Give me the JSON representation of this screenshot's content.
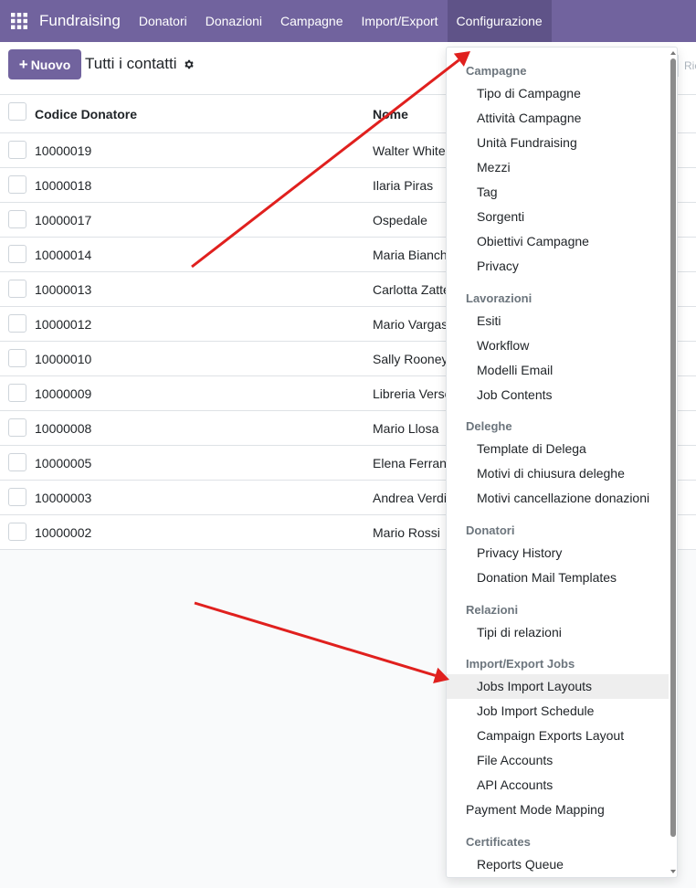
{
  "navbar": {
    "apps_icon": "grid-icon",
    "brand": "Fundraising",
    "menu": [
      "Donatori",
      "Donazioni",
      "Campagne",
      "Import/Export",
      "Configurazione"
    ],
    "accent_color": "#71639e"
  },
  "control_panel": {
    "new_button": "Nuovo",
    "breadcrumb": "Tutti i contatti",
    "settings_icon": "gear-icon",
    "search_placeholder": "Ric"
  },
  "list": {
    "columns": [
      "Codice Donatore",
      "Nome"
    ],
    "rows": [
      {
        "code": "10000019",
        "name": "Walter White"
      },
      {
        "code": "10000018",
        "name": "Ilaria Piras"
      },
      {
        "code": "10000017",
        "name": "Ospedale"
      },
      {
        "code": "10000014",
        "name": "Maria Bianchi"
      },
      {
        "code": "10000013",
        "name": "Carlotta Zatterin"
      },
      {
        "code": "10000012",
        "name": "Mario Vargas"
      },
      {
        "code": "10000010",
        "name": "Sally Rooney"
      },
      {
        "code": "10000009",
        "name": "Libreria Verso"
      },
      {
        "code": "10000008",
        "name": "Mario Llosa"
      },
      {
        "code": "10000005",
        "name": "Elena Ferrante"
      },
      {
        "code": "10000003",
        "name": "Andrea Verdi"
      },
      {
        "code": "10000002",
        "name": "Mario Rossi"
      }
    ]
  },
  "dropdown": {
    "sections": [
      {
        "header": "Campagne",
        "items": [
          "Tipo di Campagne",
          "Attività Campagne",
          "Unità Fundraising",
          "Mezzi",
          "Tag",
          "Sorgenti",
          "Obiettivi Campagne",
          "Privacy"
        ]
      },
      {
        "header": "Lavorazioni",
        "items": [
          "Esiti",
          "Workflow",
          "Modelli Email",
          "Job Contents"
        ]
      },
      {
        "header": "Deleghe",
        "items": [
          "Template di Delega",
          "Motivi di chiusura deleghe",
          "Motivi cancellazione donazioni"
        ]
      },
      {
        "header": "Donatori",
        "items": [
          "Privacy History",
          "Donation Mail Templates"
        ]
      },
      {
        "header": "Relazioni",
        "items": [
          "Tipi di relazioni"
        ]
      },
      {
        "header": "Import/Export Jobs",
        "items": [
          "Jobs Import Layouts",
          "Job Import Schedule",
          "Campaign Exports Layout",
          "File Accounts",
          "API Accounts"
        ]
      },
      {
        "top_item": "Payment Mode Mapping"
      },
      {
        "header": "Certificates",
        "items": [
          "Reports Queue"
        ]
      }
    ],
    "highlighted_item": "Jobs Import Layouts"
  },
  "annotations": {
    "arrow_color": "#e0201e"
  }
}
